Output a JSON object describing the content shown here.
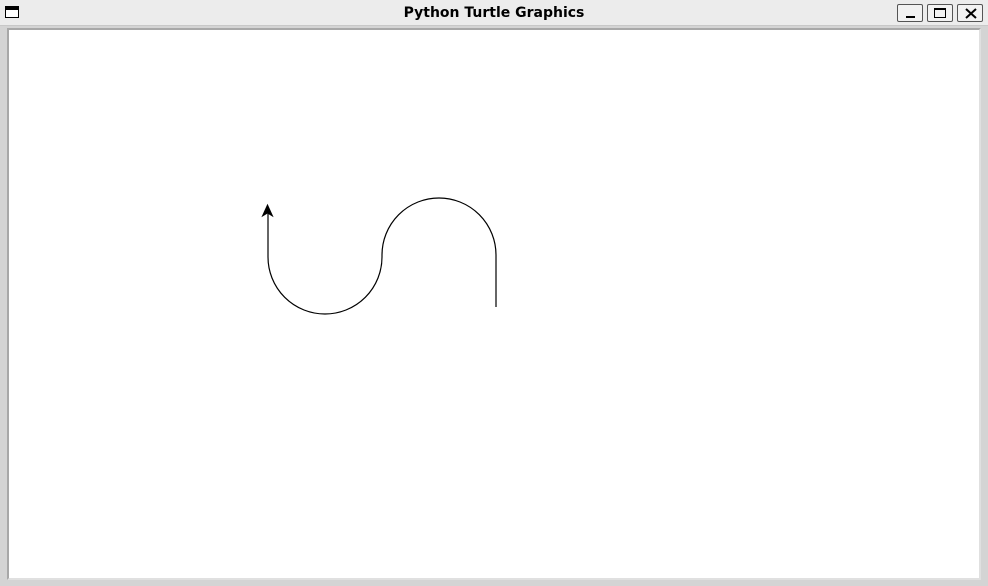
{
  "window": {
    "title": "Python Turtle Graphics",
    "system_menu_icon": "window-icon",
    "controls": [
      {
        "name": "minimize",
        "icon": "minimize-icon"
      },
      {
        "name": "maximize",
        "icon": "maximize-icon"
      },
      {
        "name": "close",
        "icon": "close-icon"
      }
    ]
  },
  "canvas": {
    "background": "#ffffff",
    "pen_color": "#000000",
    "turtle_shape": "arrow",
    "turtle_heading": "up"
  }
}
